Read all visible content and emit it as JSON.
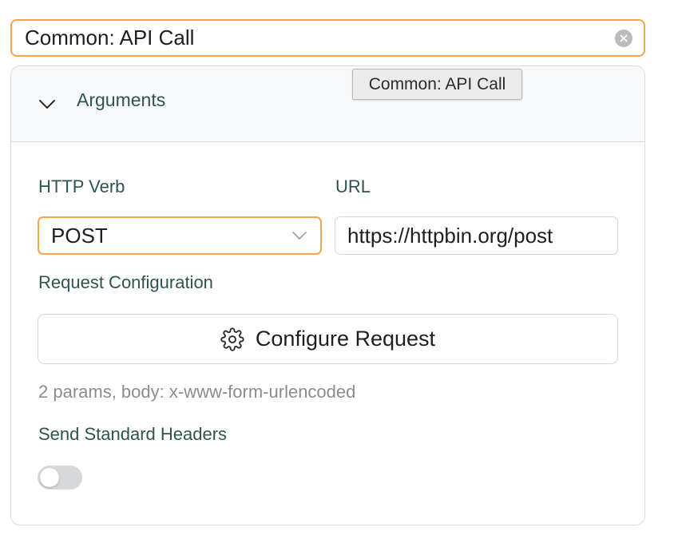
{
  "title_input": {
    "value": "Common: API Call",
    "clear_icon": "clear-circle-icon"
  },
  "tooltip": {
    "text": "Common: API Call"
  },
  "section": {
    "label": "Arguments",
    "expanded": true,
    "chevron_icon": "chevron-down-icon"
  },
  "http_verb": {
    "label": "HTTP Verb",
    "value": "POST",
    "chevron_icon": "chevron-down-icon"
  },
  "url": {
    "label": "URL",
    "value": "https://httpbin.org/post"
  },
  "request_config": {
    "label": "Request Configuration",
    "button_label": "Configure Request",
    "button_icon": "gear-icon",
    "summary": "2 params, body: x-www-form-urlencoded"
  },
  "standard_headers": {
    "label": "Send Standard Headers",
    "enabled": false
  },
  "colors": {
    "accent_focus": "#f3a64a",
    "label_text": "#2f5450",
    "muted_text": "#8a8d90",
    "border": "#d4d7da"
  }
}
